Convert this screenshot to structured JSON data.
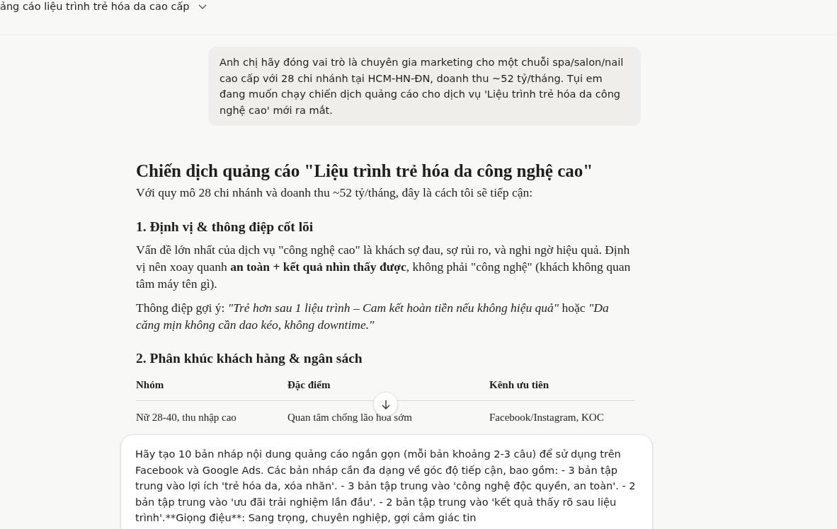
{
  "header": {
    "title": "ảng cáo liệu trình trẻ hóa da cao cấp"
  },
  "user_message": "Anh chị hãy đóng vai trò là chuyên gia marketing cho một chuỗi spa/salon/nail cao cấp với 28 chi nhánh tại HCM-HN-ĐN, doanh thu ~52 tỷ/tháng. Tụi em đang muốn chạy chiến dịch quảng cáo cho dịch vụ 'Liệu trình trẻ hóa da công nghệ cao' mới ra mắt.",
  "response": {
    "title": "Chiến dịch quảng cáo \"Liệu trình trẻ hóa da công nghệ cao\"",
    "intro": "Với quy mô 28 chi nhánh và doanh thu ~52 tỷ/tháng, đây là cách tôi sẽ tiếp cận:",
    "sections": [
      {
        "heading": "1. Định vị & thông điệp cốt lõi",
        "paragraphs": [
          "Vấn đề lớn nhất của dịch vụ \"công nghệ cao\" là khách sợ đau, sợ rủi ro, và nghi ngờ hiệu quả. Định vị nên xoay quanh **an toàn + kết quả nhìn thấy được**, không phải \"công nghệ\" (khách không quan tâm máy tên gì).",
          "Thông điệp gợi ý: *\"Trẻ hơn sau 1 liệu trình – Cam kết hoàn tiền nếu không hiệu quả\"* hoặc *\"Da căng mịn không cần dao kéo, không downtime.\"*"
        ]
      },
      {
        "heading": "2. Phân khúc khách hàng & ngân sách",
        "table": {
          "columns": [
            "Nhóm",
            "Đặc điểm",
            "Kênh ưu tiên"
          ],
          "rows": [
            [
              "Nữ 28-40, thu nhập cao",
              "Quan tâm chống lão hóa sớm",
              "Facebook/Instagram, KOC"
            ]
          ]
        }
      }
    ]
  },
  "composer": {
    "value": "Hãy tạo 10 bản nháp nội dung quảng cáo ngắn gọn (mỗi bản khoảng 2-3 câu) để sử dụng trên Facebook và Google Ads. Các bản nháp cần đa dạng về góc độ tiếp cận, bao gồm:  - 3 bản tập trung vào lợi ích 'trẻ hóa da, xóa nhăn'.  - 3 bản tập trung vào 'công nghệ độc quyền, an toàn'.  - 2 bản tập trung vào 'ưu đãi trải nghiệm lần đầu'.  - 2 bản tập trung vào 'kết quả thấy rõ sau liệu trình'.**Giọng điệu**: Sang trọng, chuyên nghiệp, gợi cảm giác tin"
  }
}
